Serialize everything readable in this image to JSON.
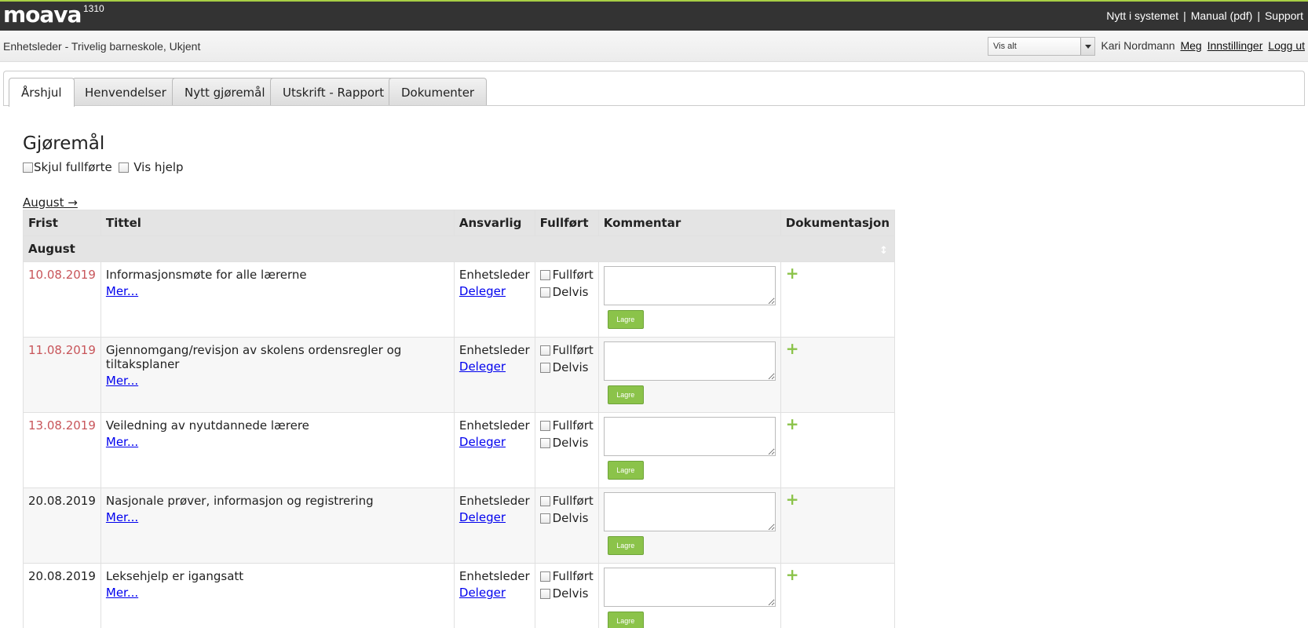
{
  "header": {
    "logo": "moava",
    "version": "1310",
    "links": [
      "Nytt i systemet",
      "Manual (pdf)",
      "Support"
    ]
  },
  "subbar": {
    "unit": "Enhetsleder - Trivelig barneskole, Ukjent",
    "filter_value": "Vis alt",
    "user": "Kari Nordmann",
    "links": [
      "Meg",
      "Innstillinger",
      "Logg ut"
    ]
  },
  "tabs": [
    "Årshjul",
    "Henvendelser",
    "Nytt gjøremål",
    "Utskrift - Rapport",
    "Dokumenter"
  ],
  "page": {
    "title": "Gjøremål",
    "option_hide": "Skjul fullførte",
    "option_help": "Vis hjelp",
    "month_link": "August →"
  },
  "table": {
    "columns": [
      "Frist",
      "Tittel",
      "Ansvarlig",
      "Fullført",
      "Kommentar",
      "Dokumentasjon"
    ],
    "group": "August",
    "sort_icon": "sort-icon",
    "more_label": "Mer...",
    "delegate_label": "Deleger",
    "done_label": "Fullført",
    "partial_label": "Delvis",
    "save_label": "Lagre",
    "rows": [
      {
        "date": "10.08.2019",
        "overdue": true,
        "title": "Informasjonsmøte for alle lærerne",
        "responsible": "Enhetsleder"
      },
      {
        "date": "11.08.2019",
        "overdue": true,
        "title": "Gjennomgang/revisjon av skolens ordensregler og tiltaksplaner",
        "responsible": "Enhetsleder"
      },
      {
        "date": "13.08.2019",
        "overdue": true,
        "title": "Veiledning av nyutdannede lærere",
        "responsible": "Enhetsleder"
      },
      {
        "date": "20.08.2019",
        "overdue": false,
        "title": "Nasjonale prøver, informasjon og registrering",
        "responsible": "Enhetsleder"
      },
      {
        "date": "20.08.2019",
        "overdue": false,
        "title": "Leksehjelp er igangsatt",
        "responsible": "Enhetsleder"
      }
    ]
  },
  "colors": {
    "accent_green": "#8bc34a",
    "overdue_red": "#c8555a",
    "topbar": "#333333"
  }
}
